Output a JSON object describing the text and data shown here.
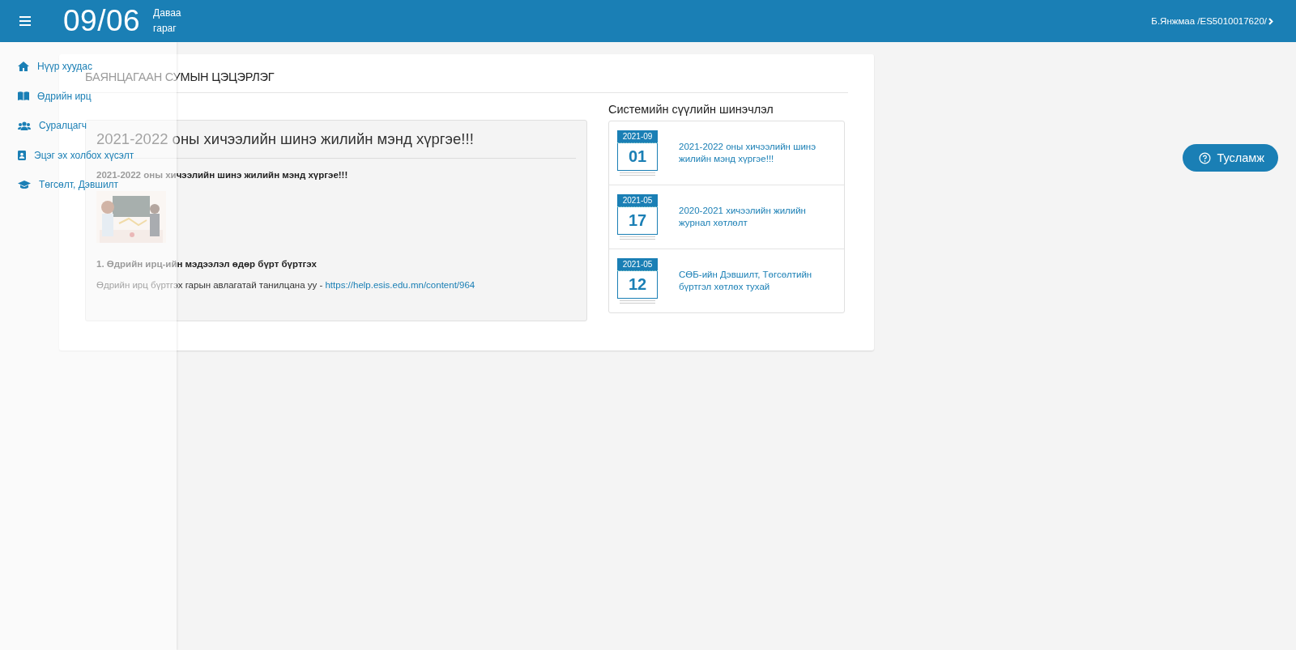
{
  "header": {
    "date": "09/06",
    "weekday": "Даваа гараг",
    "user": "Б.Янжмаа /ES5010017620/"
  },
  "sidebar": {
    "items": [
      {
        "label": "Нүүр хуудас",
        "kind": "home"
      },
      {
        "label": "Өдрийн ирц",
        "kind": "book"
      },
      {
        "label": "Суралцагч",
        "kind": "users"
      },
      {
        "label": "Эцэг эх холбох хүсэлт",
        "kind": "contact"
      },
      {
        "label": "Төгсөлт, Дэвшилт",
        "kind": "graduation"
      }
    ]
  },
  "card": {
    "title": "БАЯНЦАГААН СУМЫН ЦЭЦЭРЛЭГ",
    "announcement": {
      "title": "2021-2022 оны хичээлийн шинэ жилийн мэнд хүргэе!!!",
      "subtitle": "2021-2022 оны хичээлийн шинэ жилийн мэнд хүргэе!!!",
      "heading": "1. Өдрийн ирц-ийн мэдээлэл өдөр бүрт бүртгэх",
      "text": "Өдрийн ирц бүртгэх гарын авлагатай танилцана уу - ",
      "link": "https://help.esis.edu.mn/content/964"
    },
    "updates": {
      "heading": "Системийн сүүлийн шинэчлэл",
      "items": [
        {
          "month": "2021-09",
          "day": "01",
          "text": "2021-2022 оны хичээлийн шинэ жилийн мэнд хүргэе!!!"
        },
        {
          "month": "2021-05",
          "day": "17",
          "text": "2020-2021 хичээлийн жилийн журнал хөтлөлт"
        },
        {
          "month": "2021-05",
          "day": "12",
          "text": "СӨБ-ийн Дэвшилт, Төгсөлтийн бүртгэл хөтлөх тухай"
        }
      ]
    }
  },
  "help_button": {
    "label": "Тусламж"
  }
}
